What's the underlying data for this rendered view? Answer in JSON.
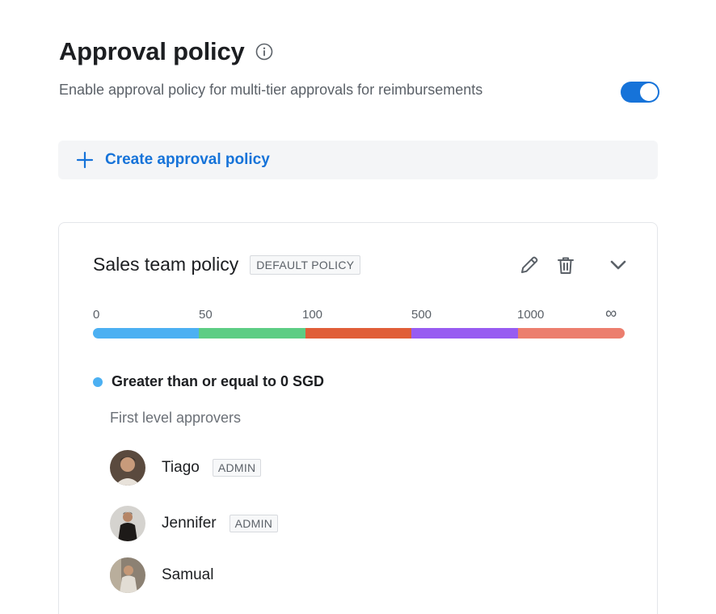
{
  "header": {
    "title": "Approval policy",
    "subtitle": "Enable approval policy for multi-tier approvals for reimbursements",
    "toggle_enabled": true
  },
  "create": {
    "label": "Create approval policy"
  },
  "policy": {
    "name": "Sales team policy",
    "badge": "DEFAULT POLICY",
    "tiers": [
      {
        "label": "0",
        "color": "#4cb0f2"
      },
      {
        "label": "50",
        "color": "#5dcd84"
      },
      {
        "label": "100",
        "color": "#e05e38"
      },
      {
        "label": "500",
        "color": "#985cf1"
      },
      {
        "label": "1000",
        "color": "#ec7e6e"
      }
    ],
    "infinity_label": "∞",
    "range": {
      "text": "Greater than or equal to 0 SGD",
      "color": "#4cb0f2"
    },
    "approvers_heading": "First level approvers",
    "approvers": [
      {
        "name": "Tiago",
        "role": "ADMIN",
        "avatar": "avatar-photo"
      },
      {
        "name": "Jennifer",
        "role": "ADMIN",
        "avatar": "avatar-photo"
      },
      {
        "name": "Samual",
        "role": "",
        "avatar": "avatar-photo"
      }
    ]
  },
  "colors": {
    "accent": "#1673d9",
    "text_primary": "#1c1e21",
    "text_secondary": "#5b6168"
  }
}
